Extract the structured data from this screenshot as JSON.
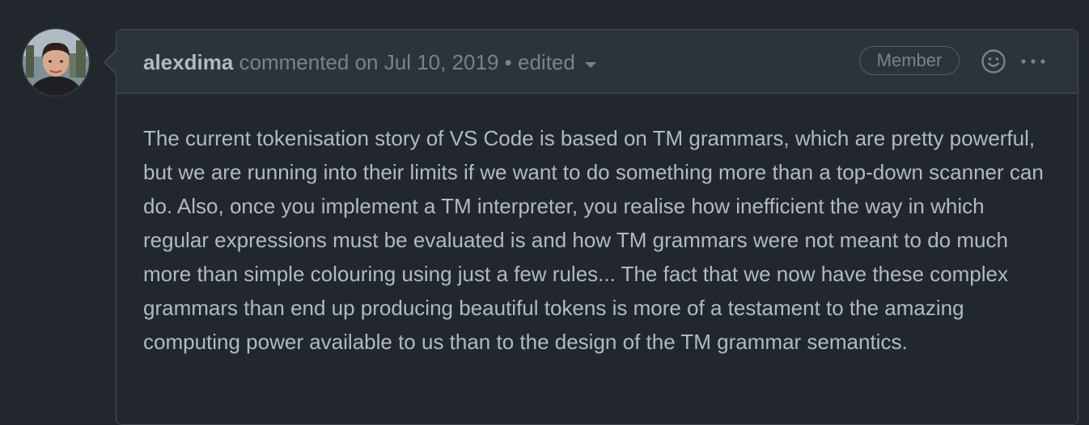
{
  "comment": {
    "author": "alexdima",
    "action": "commented on",
    "date": "Jul 10, 2019",
    "separator": "•",
    "edited_label": "edited",
    "badge": "Member",
    "body": "The current tokenisation story of VS Code is based on TM grammars, which are pretty powerful, but we are running into their limits if we want to do something more than a top-down scanner can do. Also, once you implement a TM interpreter, you realise how inefficient the way in which regular expressions must be evaluated is and how TM grammars were not meant to do much more than simple colouring using just a few rules... The fact that we now have these complex grammars than end up producing beautiful tokens is more of a testament to the amazing computing power available to us than to the design of the TM grammar semantics."
  },
  "icons": {
    "avatar": "user-avatar",
    "reaction": "smiley-icon",
    "more": "kebab-horizontal-icon",
    "edited_dropdown": "caret-down-icon"
  },
  "colors": {
    "background": "#22272e",
    "header_background": "#2d333b",
    "border": "#444c56",
    "text_primary": "#adbac7",
    "text_muted": "#768390"
  }
}
